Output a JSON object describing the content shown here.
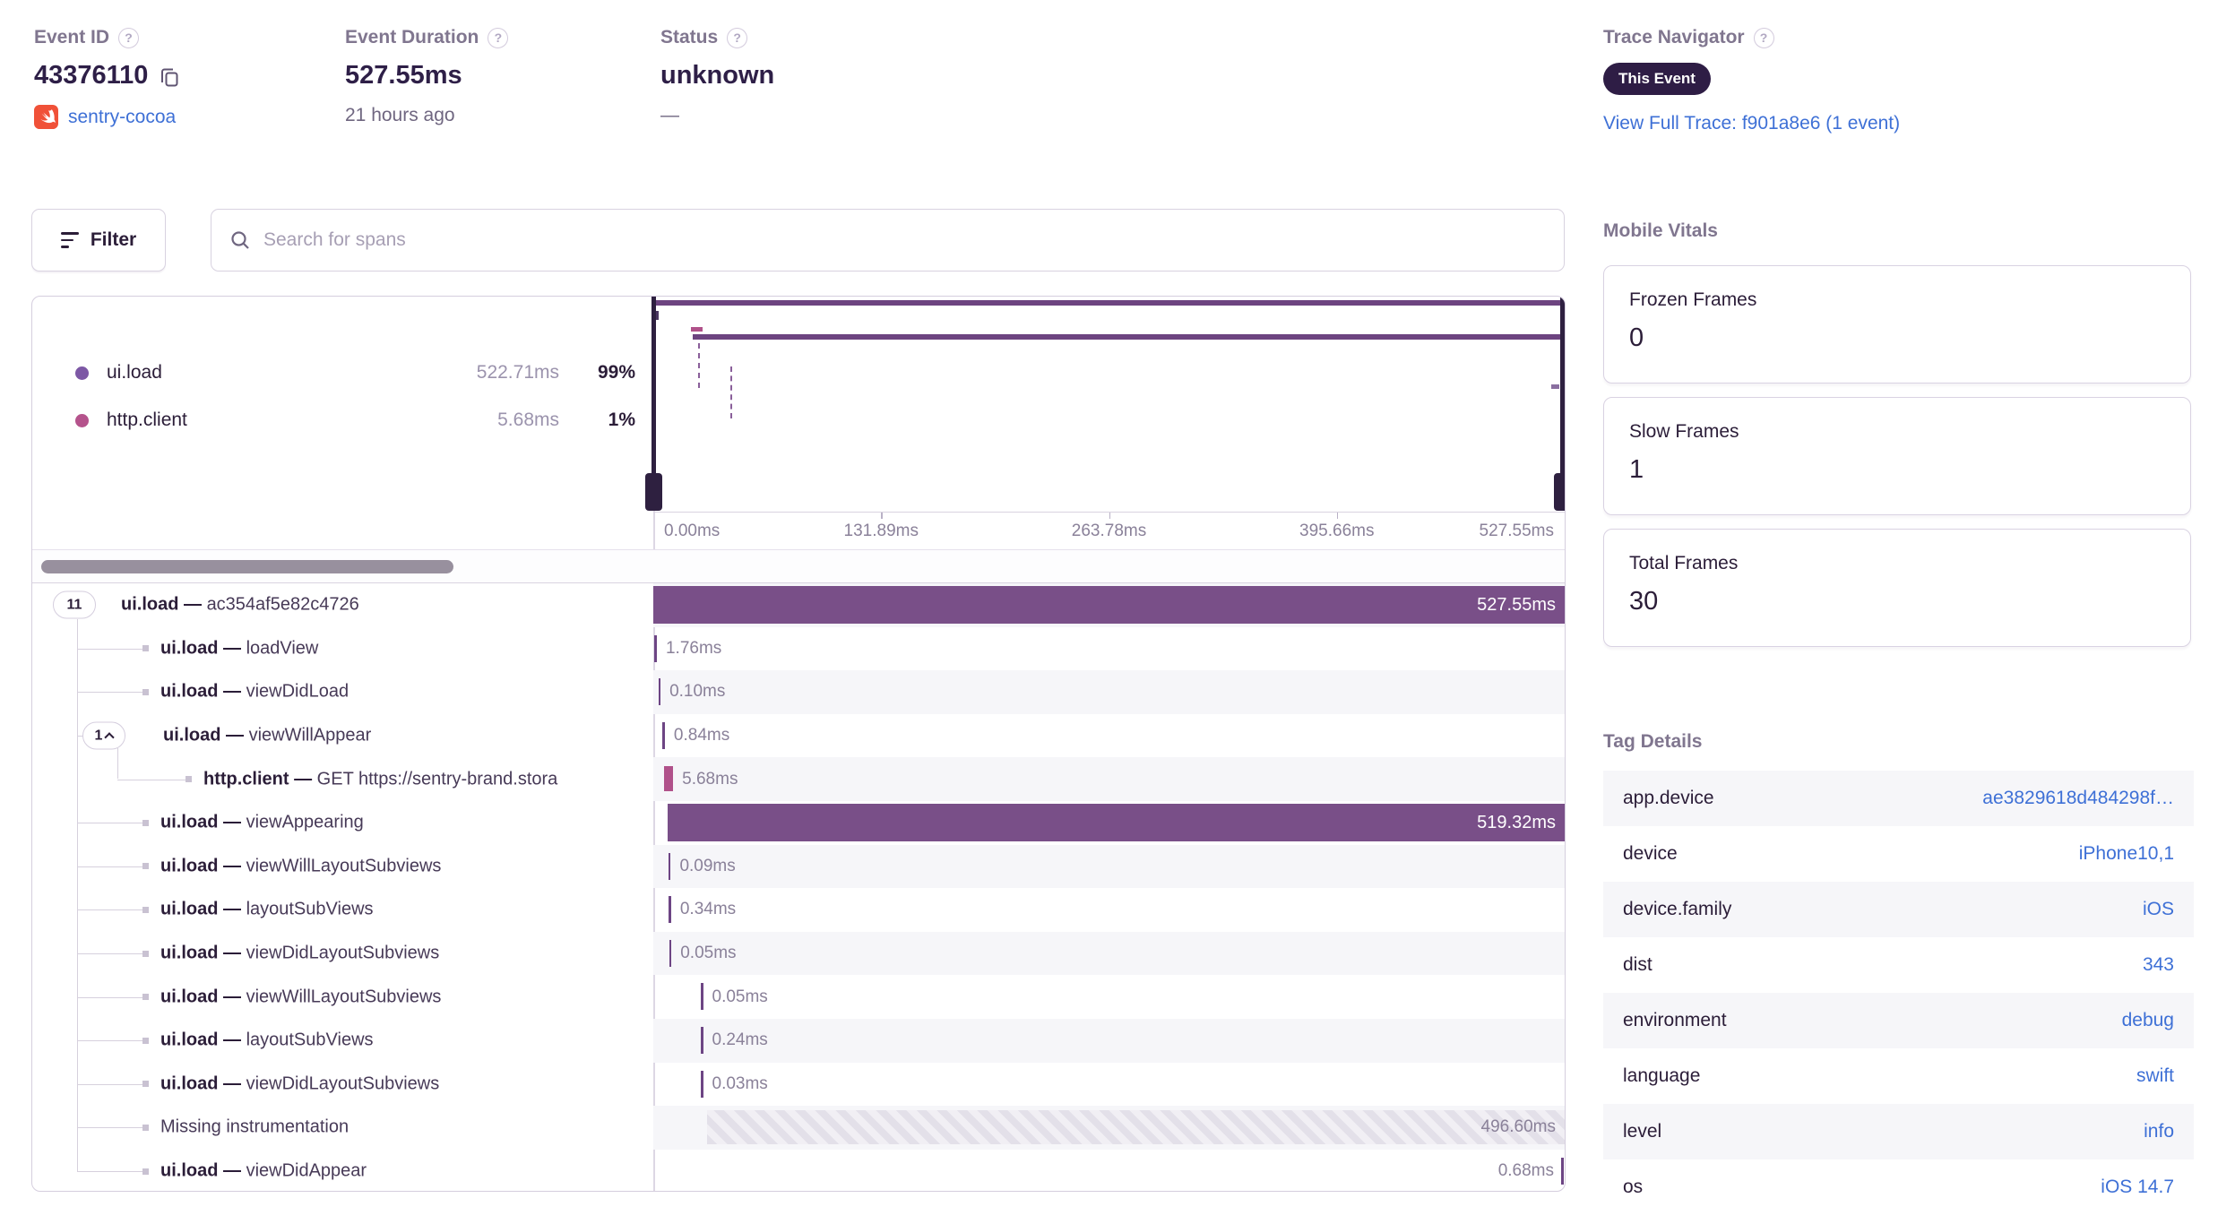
{
  "header": {
    "event_id": {
      "label": "Event ID",
      "value": "43376110",
      "project": "sentry-cocoa"
    },
    "event_duration": {
      "label": "Event Duration",
      "value": "527.55ms",
      "age": "21 hours ago"
    },
    "status": {
      "label": "Status",
      "value": "unknown",
      "sub": "—"
    },
    "trace_navigator": {
      "label": "Trace Navigator",
      "badge": "This Event",
      "link": "View Full Trace: f901a8e6 (1 event)"
    }
  },
  "toolbar": {
    "filter_label": "Filter",
    "search_placeholder": "Search for spans"
  },
  "legend": [
    {
      "op": "ui.load",
      "duration": "522.71ms",
      "percent": "99%",
      "color": "#7d58a5"
    },
    {
      "op": "http.client",
      "duration": "5.68ms",
      "percent": "1%",
      "color": "#b5538c"
    }
  ],
  "minimap_axis": [
    "0.00ms",
    "131.89ms",
    "263.78ms",
    "395.66ms",
    "527.55ms"
  ],
  "spans": {
    "separator": "—",
    "total_ms": 527.55,
    "rows": [
      {
        "op": "ui.load",
        "desc": "ac354af5e82c4726",
        "pill": "11",
        "depth": 0,
        "bar": "bar",
        "start_ms": 0,
        "dur_ms": 527.55,
        "label": "527.55ms"
      },
      {
        "op": "ui.load",
        "desc": "loadView",
        "depth": 1,
        "bar": "tick",
        "start_ms": 0.3,
        "dur_ms": 1.76,
        "label": "1.76ms"
      },
      {
        "op": "ui.load",
        "desc": "viewDidLoad",
        "depth": 1,
        "bar": "tick",
        "start_ms": 2.9,
        "dur_ms": 0.1,
        "label": "0.10ms"
      },
      {
        "op": "ui.load",
        "desc": "viewWillAppear",
        "pill": "1",
        "pill_expanded": true,
        "depth": 1,
        "bar": "tick",
        "start_ms": 5.4,
        "dur_ms": 0.84,
        "label": "0.84ms"
      },
      {
        "op": "http.client",
        "desc": "GET https://sentry-brand.stora",
        "depth": 2,
        "bar": "tick",
        "tick_style": "http",
        "start_ms": 6.3,
        "dur_ms": 5.68,
        "label": "5.68ms"
      },
      {
        "op": "ui.load",
        "desc": "viewAppearing",
        "depth": 1,
        "bar": "bar",
        "start_ms": 8.23,
        "dur_ms": 519.32,
        "label": "519.32ms"
      },
      {
        "op": "ui.load",
        "desc": "viewWillLayoutSubviews",
        "depth": 1,
        "bar": "tick",
        "start_ms": 8.8,
        "dur_ms": 0.09,
        "label": "0.09ms"
      },
      {
        "op": "ui.load",
        "desc": "layoutSubViews",
        "depth": 1,
        "bar": "tick",
        "start_ms": 9.0,
        "dur_ms": 0.34,
        "label": "0.34ms"
      },
      {
        "op": "ui.load",
        "desc": "viewDidLayoutSubviews",
        "depth": 1,
        "bar": "tick",
        "start_ms": 9.2,
        "dur_ms": 0.05,
        "label": "0.05ms"
      },
      {
        "op": "ui.load",
        "desc": "viewWillLayoutSubviews",
        "depth": 1,
        "bar": "tick",
        "start_ms": 27.5,
        "dur_ms": 0.05,
        "label": "0.05ms"
      },
      {
        "op": "ui.load",
        "desc": "layoutSubViews",
        "depth": 1,
        "bar": "tick",
        "start_ms": 27.5,
        "dur_ms": 0.24,
        "label": "0.24ms"
      },
      {
        "op": "ui.load",
        "desc": "viewDidLayoutSubviews",
        "depth": 1,
        "bar": "tick",
        "start_ms": 27.5,
        "dur_ms": 0.03,
        "label": "0.03ms"
      },
      {
        "op": "",
        "desc": "Missing instrumentation",
        "depth": 1,
        "bar": "hatched",
        "start_ms": 30.95,
        "dur_ms": 496.6,
        "label": "496.60ms"
      },
      {
        "op": "ui.load",
        "desc": "viewDidAppear",
        "depth": 1,
        "bar": "tick_end",
        "start_ms": 526.87,
        "dur_ms": 0.68,
        "label": "0.68ms"
      }
    ]
  },
  "vitals": {
    "title": "Mobile Vitals",
    "cards": [
      {
        "label": "Frozen Frames",
        "value": "0"
      },
      {
        "label": "Slow Frames",
        "value": "1"
      },
      {
        "label": "Total Frames",
        "value": "30"
      }
    ]
  },
  "tags": {
    "title": "Tag Details",
    "rows": [
      {
        "key": "app.device",
        "value": "ae3829618d484298f…"
      },
      {
        "key": "device",
        "value": "iPhone10,1"
      },
      {
        "key": "device.family",
        "value": "iOS"
      },
      {
        "key": "dist",
        "value": "343"
      },
      {
        "key": "environment",
        "value": "debug"
      },
      {
        "key": "language",
        "value": "swift"
      },
      {
        "key": "level",
        "value": "info"
      },
      {
        "key": "os",
        "value": "iOS 14.7"
      }
    ]
  },
  "colors": {
    "bar_purple": "#794f88",
    "tick_purple": "#6d4584",
    "http_pink": "#b0518a",
    "link_blue": "#3e70d6",
    "badge_bg": "#2e1d45",
    "minimap_line": "#6d4480",
    "handle": "#2e2040"
  }
}
